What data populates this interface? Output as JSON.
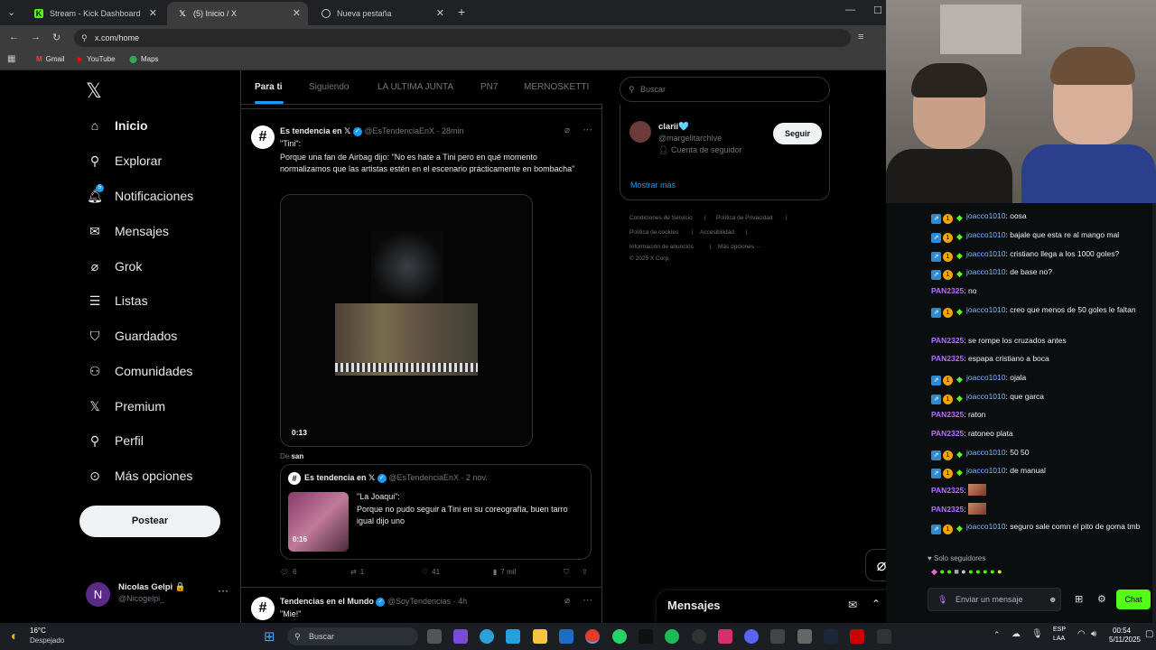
{
  "browser": {
    "tabs": [
      {
        "title": "Stream - Kick Dashboard",
        "active": false
      },
      {
        "title": "(5) Inicio / X",
        "active": true
      },
      {
        "title": "Nueva pestaña",
        "active": false
      }
    ],
    "url": "x.com/home",
    "bookmarks": [
      "Gmail",
      "YouTube",
      "Maps"
    ]
  },
  "x": {
    "nav": [
      "Inicio",
      "Explorar",
      "Notificaciones",
      "Mensajes",
      "Grok",
      "Listas",
      "Guardados",
      "Comunidades",
      "Premium",
      "Perfil",
      "Más opciones"
    ],
    "post_button": "Postear",
    "notif_count": "5",
    "account": {
      "name": "Nicolas Gelpi 🔒",
      "handle": "@Nicogelpi_",
      "initial": "N"
    },
    "feed_tabs": [
      "Para ti",
      "Siguiendo",
      "LA ULTIMA JUNTA",
      "PN7",
      "MERNOSKETTI"
    ],
    "tweet": {
      "author": "Es tendencia en 𝕏",
      "handle": "@EsTendenciaEnX",
      "time": "28min",
      "line1": "\"Tini\":",
      "text": "Porque una fan de Airbag dijo: \"No es hate a Tini pero en qué momento normalizamos que las artistas estén en el escenario prácticamente en bombacha\"",
      "video_time": "0:13",
      "from_label": "De",
      "from_user": "san",
      "quote": {
        "author": "Es tendencia en 𝕏",
        "handle": "@EsTendenciaEnX",
        "time": "2 nov.",
        "title": "\"La Joaqui\":",
        "text": "Porque no pudo seguir a Tini en su coreografía, buen tarro igual dijo uno",
        "video_time": "0:16"
      },
      "replies": "6",
      "retweets": "1",
      "likes": "41",
      "views": "7 mil"
    },
    "next_tweet": {
      "author": "Tendencias en el Mundo",
      "handle": "@SoyTendencias",
      "time": "4h",
      "text": "\"Mie!\""
    },
    "search_placeholder": "Buscar",
    "who_to_follow": {
      "name": "clarii🩵",
      "handle": "@margelitarchive",
      "note": "Cuenta de seguidor",
      "follow_label": "Seguir",
      "more": "Mostrar más"
    },
    "footer": [
      "Condiciones de Servicio",
      "Política de Privacidad",
      "Política de cookies",
      "Accesibilidad",
      "Información de anuncios",
      "Más opciones ···",
      "© 2025 X Corp."
    ],
    "messages_label": "Mensajes"
  },
  "chat": {
    "messages": [
      {
        "user": "joacco1010",
        "type": "j",
        "text": "oosa"
      },
      {
        "user": "joacco1010",
        "type": "j",
        "text": "bajale que esta re al mango mal"
      },
      {
        "user": "joacco1010",
        "type": "j",
        "text": "cristiano llega a los 1000 goles?"
      },
      {
        "user": "joacco1010",
        "type": "j",
        "text": "de base no?"
      },
      {
        "user": "PAN2325",
        "type": "p",
        "text": "no"
      },
      {
        "user": "joacco1010",
        "type": "j",
        "text": "creo que menos de 50 goles le faltan"
      },
      {
        "user": "PAN2325",
        "type": "p",
        "text": "se rompe los cruzados antes"
      },
      {
        "user": "PAN2325",
        "type": "p",
        "text": "espapa cristiano a boca"
      },
      {
        "user": "joacco1010",
        "type": "j",
        "text": "ojala"
      },
      {
        "user": "joacco1010",
        "type": "j",
        "text": "que garca"
      },
      {
        "user": "PAN2325",
        "type": "p",
        "text": "raton"
      },
      {
        "user": "PAN2325",
        "type": "p",
        "text": "ratoneo plata"
      },
      {
        "user": "joacco1010",
        "type": "j",
        "text": "50 50"
      },
      {
        "user": "joacco1010",
        "type": "j",
        "text": "de manual"
      },
      {
        "user": "PAN2325",
        "type": "p",
        "text": ""
      },
      {
        "user": "PAN2325",
        "type": "p",
        "text": ""
      },
      {
        "user": "joacco1010",
        "type": "j",
        "text": "seguro sale comn el pito de goma tmb"
      }
    ],
    "followers_only": "Solo seguidores",
    "input_placeholder": "Enviar un mensaje",
    "send_label": "Chat"
  },
  "taskbar": {
    "temp": "16°C",
    "weather": "Despejado",
    "search": "Buscar",
    "lang1": "ESP",
    "lang2": "LAA",
    "time": "00:54",
    "date": "5/11/2025"
  },
  "colors": {
    "accent": "#1d9bf0",
    "kick_green": "#53fc18",
    "chat_user_j": "#7fb4ff",
    "chat_user_p": "#b56cff"
  }
}
